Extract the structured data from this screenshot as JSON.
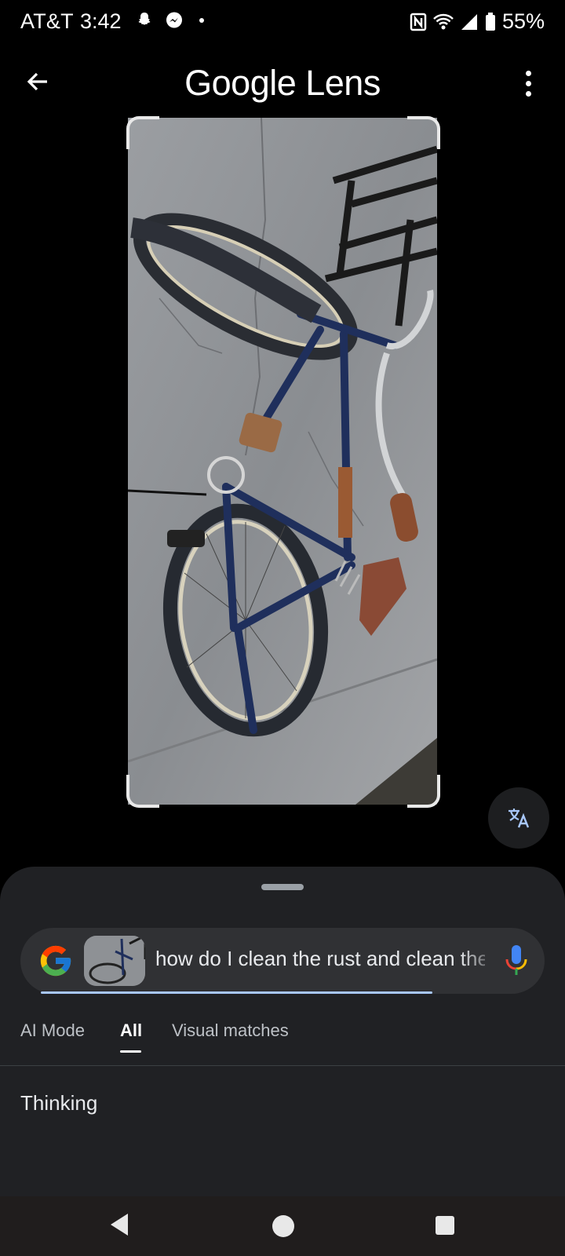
{
  "status_bar": {
    "carrier": "AT&T",
    "time": "3:42",
    "battery": "55%"
  },
  "app_bar": {
    "title": "Google Lens",
    "back_icon": "arrow-back-icon",
    "menu_icon": "more-vert-icon"
  },
  "image": {
    "subject_icon": "bicycle-photo",
    "translate_icon": "translate-icon"
  },
  "search": {
    "query": "how do I clean the rust and clean the bike",
    "logo": "google-g-icon",
    "mic_icon": "mic-icon",
    "progress": 0.78
  },
  "tabs": [
    {
      "label": "AI Mode",
      "active": false
    },
    {
      "label": "All",
      "active": true
    },
    {
      "label": "Visual matches",
      "active": false
    }
  ],
  "results": {
    "status": "Thinking"
  },
  "colors": {
    "sheet_bg": "#202124",
    "pill_bg": "#303134",
    "progress": "#a8c7fa"
  }
}
